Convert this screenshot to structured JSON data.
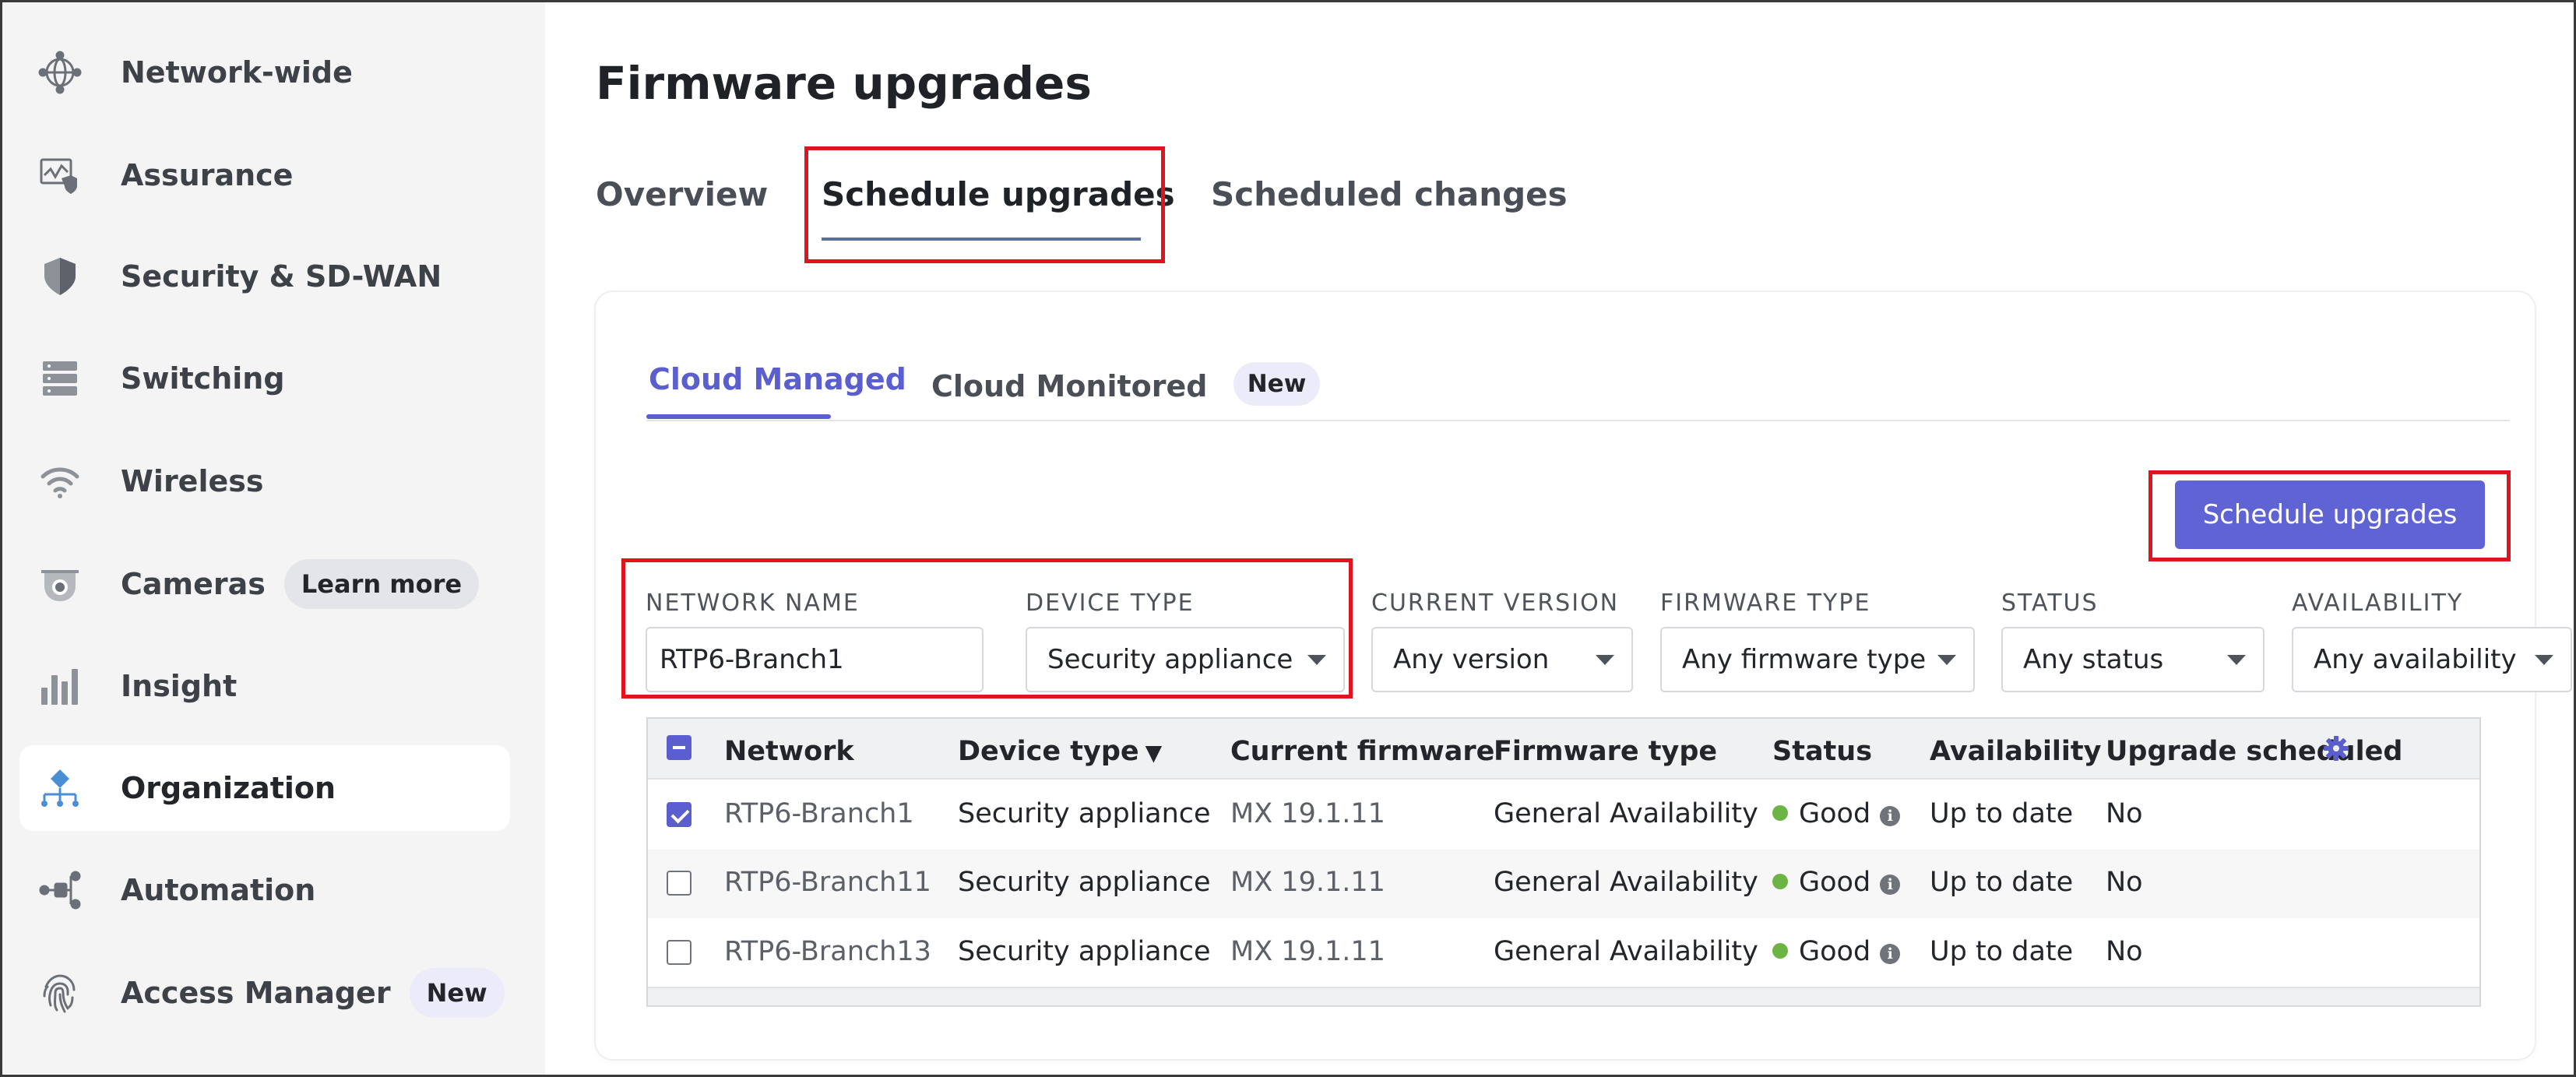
{
  "sidebar": {
    "items": [
      {
        "label": "Network-wide",
        "icon": "globe-network-icon"
      },
      {
        "label": "Assurance",
        "icon": "assurance-chart-shield-icon"
      },
      {
        "label": "Security & SD-WAN",
        "icon": "shield-icon"
      },
      {
        "label": "Switching",
        "icon": "switch-stack-icon"
      },
      {
        "label": "Wireless",
        "icon": "wifi-icon"
      },
      {
        "label": "Cameras",
        "icon": "camera-icon",
        "pill": "Learn more"
      },
      {
        "label": "Insight",
        "icon": "bar-chart-icon"
      },
      {
        "label": "Organization",
        "icon": "organization-tree-icon",
        "active": true
      },
      {
        "label": "Automation",
        "icon": "automation-flow-icon"
      },
      {
        "label": "Access Manager",
        "icon": "fingerprint-icon",
        "pill": "New"
      }
    ]
  },
  "page": {
    "title": "Firmware upgrades",
    "tabs": [
      {
        "label": "Overview"
      },
      {
        "label": "Schedule upgrades",
        "active": true
      },
      {
        "label": "Scheduled changes"
      }
    ]
  },
  "subtabs": [
    {
      "label": "Cloud Managed",
      "active": true
    },
    {
      "label": "Cloud Monitored",
      "badge": "New"
    }
  ],
  "actions": {
    "schedule_button": "Schedule upgrades"
  },
  "filters": {
    "network_name": {
      "label": "NETWORK NAME",
      "value": "RTP6-Branch1"
    },
    "device_type": {
      "label": "DEVICE TYPE",
      "value": "Security appliance"
    },
    "current_version": {
      "label": "CURRENT VERSION",
      "value": "Any version"
    },
    "firmware_type": {
      "label": "FIRMWARE TYPE",
      "value": "Any firmware type"
    },
    "status": {
      "label": "STATUS",
      "value": "Any status"
    },
    "availability": {
      "label": "AVAILABILITY",
      "value": "Any availability"
    }
  },
  "table": {
    "columns": [
      "Network",
      "Device type",
      "Current firmware",
      "Firmware type",
      "Status",
      "Availability",
      "Upgrade scheduled"
    ],
    "sort_indicator": "▼",
    "rows": [
      {
        "network": "RTP6-Branch1",
        "device_type": "Security appliance",
        "firmware": "MX 19.1.11",
        "firmware_type": "General Availability",
        "status": "Good",
        "availability": "Up to date",
        "scheduled": "No",
        "checked": true
      },
      {
        "network": "RTP6-Branch11",
        "device_type": "Security appliance",
        "firmware": "MX 19.1.11",
        "firmware_type": "General Availability",
        "status": "Good",
        "availability": "Up to date",
        "scheduled": "No",
        "checked": false
      },
      {
        "network": "RTP6-Branch13",
        "device_type": "Security appliance",
        "firmware": "MX 19.1.11",
        "firmware_type": "General Availability",
        "status": "Good",
        "availability": "Up to date",
        "scheduled": "No",
        "checked": false
      }
    ],
    "info_glyph": "i"
  },
  "colors": {
    "accent": "#5a5ecf",
    "primary_button": "#5f63d4",
    "status_good": "#6cb545",
    "highlight_box": "#e0141e"
  }
}
